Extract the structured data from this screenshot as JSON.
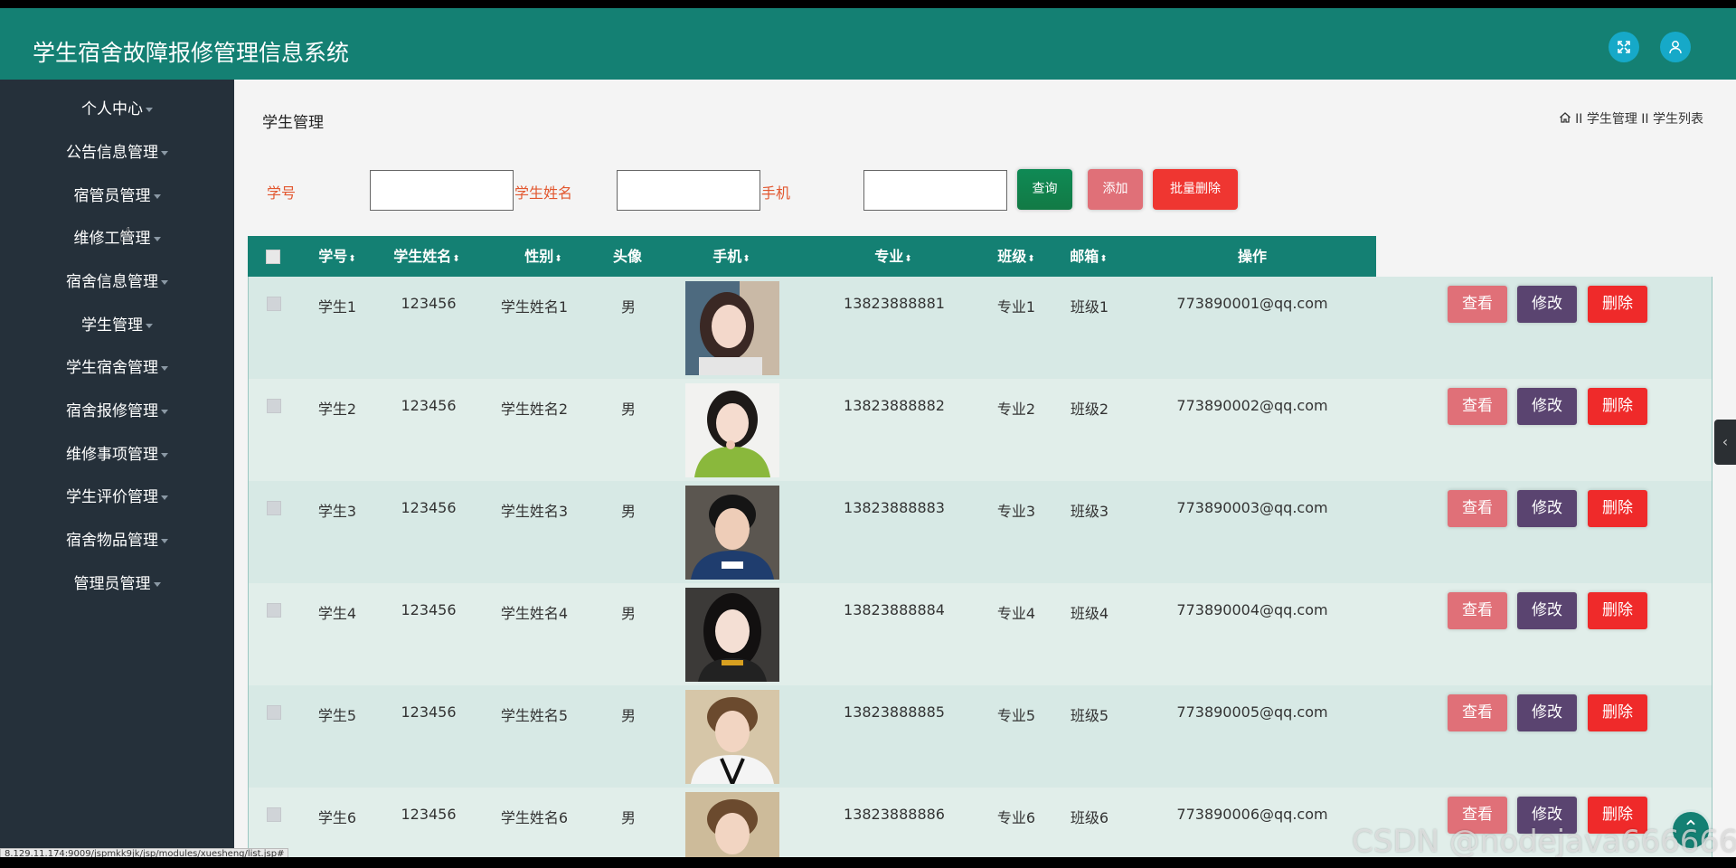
{
  "app": {
    "title": "学生宿舍故障报修管理信息系统"
  },
  "header": {
    "expand_icon": "fullscreen-icon",
    "user_icon": "user-icon"
  },
  "sidebar": {
    "items": [
      {
        "label": "个人中心"
      },
      {
        "label": "公告信息管理"
      },
      {
        "label": "宿管员管理"
      },
      {
        "label": "维修工管理"
      },
      {
        "label": "宿舍信息管理"
      },
      {
        "label": "学生管理"
      },
      {
        "label": "学生宿舍管理"
      },
      {
        "label": "宿舍报修管理"
      },
      {
        "label": "维修事项管理"
      },
      {
        "label": "学生评价管理"
      },
      {
        "label": "宿舍物品管理"
      },
      {
        "label": "管理员管理"
      }
    ]
  },
  "page": {
    "title": "学生管理",
    "breadcrumb": "II 学生管理 II 学生列表"
  },
  "search": {
    "xuehao_label": "学号",
    "name_label": "学生姓名",
    "phone_label": "手机",
    "xuehao_value": "",
    "name_value": "",
    "phone_value": "",
    "query_button": "查询",
    "add_button": "添加",
    "batch_delete_button": "批量删除"
  },
  "table": {
    "columns": [
      "学号",
      "学生姓名",
      "性别",
      "头像",
      "手机",
      "专业",
      "班级",
      "邮箱",
      "操作"
    ],
    "actions": {
      "view": "查看",
      "edit": "修改",
      "delete": "删除"
    },
    "rows": [
      {
        "c1": "学生1",
        "c2": "123456",
        "c3": "学生姓名1",
        "c4": "男",
        "c5": "13823888881",
        "c6": "专业1",
        "c7": "班级1",
        "c8": "773890001@qq.com"
      },
      {
        "c1": "学生2",
        "c2": "123456",
        "c3": "学生姓名2",
        "c4": "男",
        "c5": "13823888882",
        "c6": "专业2",
        "c7": "班级2",
        "c8": "773890002@qq.com"
      },
      {
        "c1": "学生3",
        "c2": "123456",
        "c3": "学生姓名3",
        "c4": "男",
        "c5": "13823888883",
        "c6": "专业3",
        "c7": "班级3",
        "c8": "773890003@qq.com"
      },
      {
        "c1": "学生4",
        "c2": "123456",
        "c3": "学生姓名4",
        "c4": "男",
        "c5": "13823888884",
        "c6": "专业4",
        "c7": "班级4",
        "c8": "773890004@qq.com"
      },
      {
        "c1": "学生5",
        "c2": "123456",
        "c3": "学生姓名5",
        "c4": "男",
        "c5": "13823888885",
        "c6": "专业5",
        "c7": "班级5",
        "c8": "773890005@qq.com"
      },
      {
        "c1": "学生6",
        "c2": "123456",
        "c3": "学生姓名6",
        "c4": "男",
        "c5": "13823888886",
        "c6": "专业6",
        "c7": "班级6",
        "c8": "773890006@qq.com"
      }
    ]
  },
  "status_bar": {
    "url": "8.129.11.174:9009/jspmkk9jk/jsp/modules/xuesheng/list.jsp#"
  },
  "watermark": "CSDN @nodejava666666",
  "colors": {
    "header": "#148073",
    "sidebar": "#25303a",
    "view_button": "#e07078",
    "edit_button": "#5a4470",
    "delete_button": "#ef2a2a"
  }
}
